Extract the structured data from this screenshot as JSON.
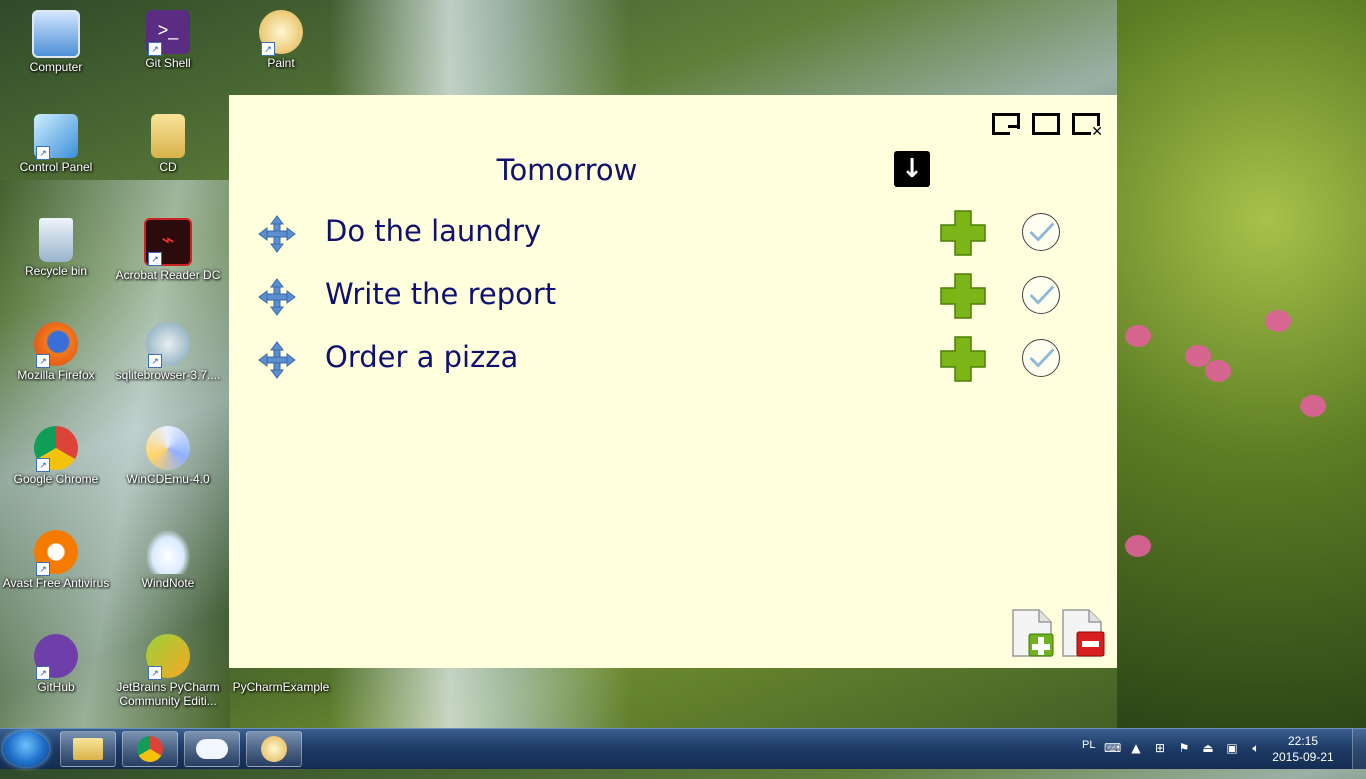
{
  "desktop": {
    "icons": [
      {
        "label": "Computer"
      },
      {
        "label": "Git Shell"
      },
      {
        "label": "Paint"
      },
      {
        "label": "Control Panel"
      },
      {
        "label": "CD"
      },
      {
        "label": "Recycle bin"
      },
      {
        "label": "Acrobat Reader DC"
      },
      {
        "label": "Mozilla Firefox"
      },
      {
        "label": "sqlitebrowser-3.7...."
      },
      {
        "label": "Google Chrome"
      },
      {
        "label": "WinCDEmu-4.0"
      },
      {
        "label": "Avast Free Antivirus"
      },
      {
        "label": "WindNote"
      },
      {
        "label": "GitHub"
      },
      {
        "label": "JetBrains PyCharm Community Editi..."
      },
      {
        "label": "PyCharmExample"
      }
    ]
  },
  "app": {
    "title": "Tomorrow",
    "tasks": [
      {
        "text": "Do the laundry"
      },
      {
        "text": "Write the report"
      },
      {
        "text": "Order a pizza"
      }
    ],
    "colors": {
      "background": "#ffffdd",
      "text": "#101070",
      "plus": "#7cb518"
    }
  },
  "taskbar": {
    "language": "PL",
    "time": "22:15",
    "date": "2015-09-21"
  }
}
